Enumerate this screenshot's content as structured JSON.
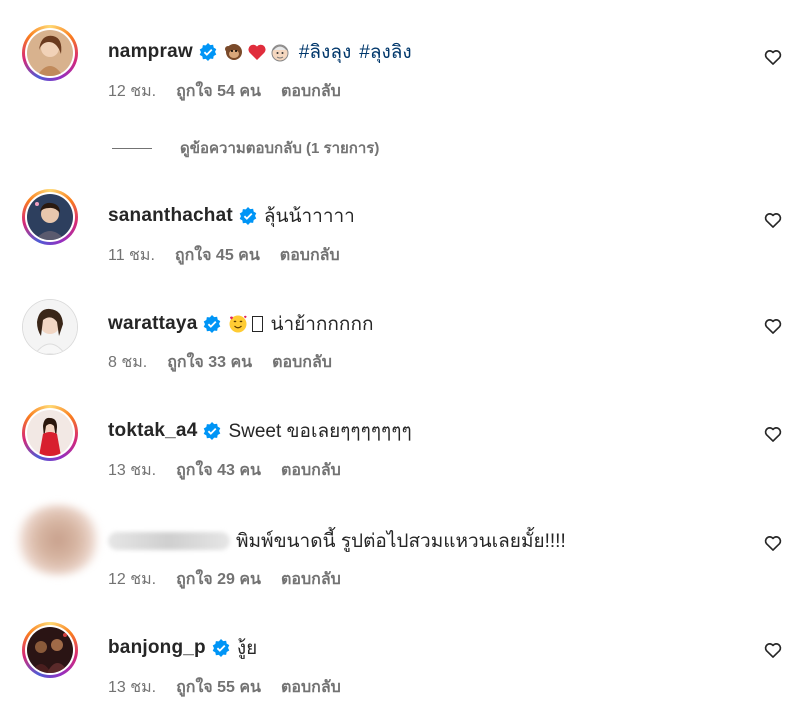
{
  "colors": {
    "verified": "#0095f6",
    "text": "#262626",
    "meta": "#737373",
    "hashtag": "#00376b"
  },
  "view_replies": {
    "label": "ดูข้อความตอบกลับ (1 รายการ)"
  },
  "comments": [
    {
      "username": "nampraw",
      "verified": true,
      "emojis": [
        "monkey-emoji",
        "heart-emoji",
        "old-man-emoji"
      ],
      "text": "",
      "hashtags": [
        "#ลิงลุง",
        "#ลุงลิง"
      ],
      "time": "12 ชม.",
      "likes": "ถูกใจ 54 คน",
      "reply": "ตอบกลับ"
    },
    {
      "username": "sananthachat",
      "verified": true,
      "text": "ลุ้นน้าาาาา",
      "time": "11 ชม.",
      "likes": "ถูกใจ 45 คน",
      "reply": "ตอบกลับ"
    },
    {
      "username": "warattaya",
      "verified": true,
      "emojis": [
        "smiling-face-with-hearts-emoji"
      ],
      "text": "น่าย้ากกกกก",
      "time": "8 ชม.",
      "likes": "ถูกใจ 33 คน",
      "reply": "ตอบกลับ"
    },
    {
      "username": "toktak_a4",
      "verified": true,
      "text": "Sweet ขอเลยๆๆๆๆๆๆๆ",
      "time": "13 ชม.",
      "likes": "ถูกใจ 43 คน",
      "reply": "ตอบกลับ"
    },
    {
      "username": "",
      "verified": false,
      "text": "พิมพ์ขนาดนี้ รูปต่อไปสวมแหวนเลยมั้ย!!!!",
      "time": "12 ชม.",
      "likes": "ถูกใจ 29 คน",
      "reply": "ตอบกลับ"
    },
    {
      "username": "banjong_p",
      "verified": true,
      "text": "งู้ย",
      "time": "13 ชม.",
      "likes": "ถูกใจ 55 คน",
      "reply": "ตอบกลับ"
    }
  ]
}
